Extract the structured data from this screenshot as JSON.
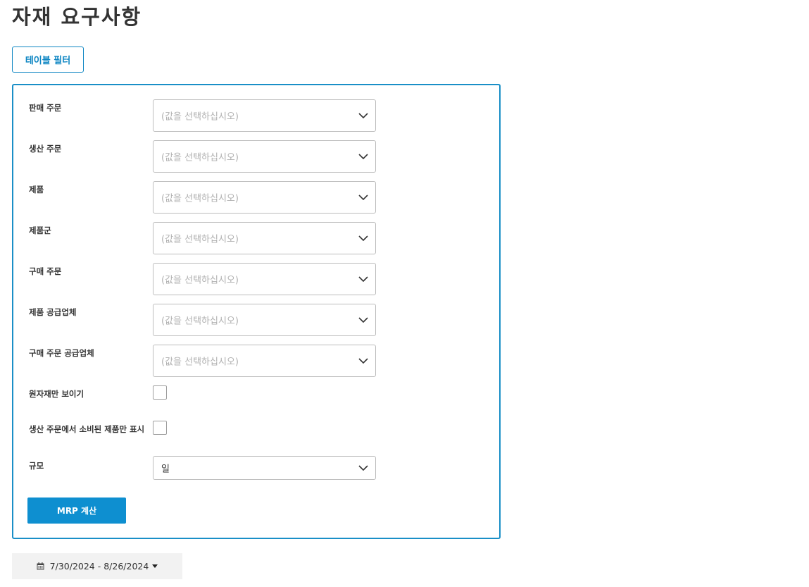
{
  "page": {
    "title": "자재 요구사항"
  },
  "toolbar": {
    "filter_toggle_label": "테이블 필터"
  },
  "filters": {
    "fields": [
      {
        "label": "판매 주문",
        "placeholder": "(값을 선택하십시오)"
      },
      {
        "label": "생산 주문",
        "placeholder": "(값을 선택하십시오)"
      },
      {
        "label": "제품",
        "placeholder": "(값을 선택하십시오)"
      },
      {
        "label": "제품군",
        "placeholder": "(값을 선택하십시오)"
      },
      {
        "label": "구매 주문",
        "placeholder": "(값을 선택하십시오)"
      },
      {
        "label": "제품 공급업체",
        "placeholder": "(값을 선택하십시오)"
      },
      {
        "label": "구매 주문 공급업체",
        "placeholder": "(값을 선택하십시오)"
      }
    ],
    "checkboxes": [
      {
        "label": "원자재만 보이기",
        "checked": false
      },
      {
        "label": "생산 주문에서 소비된 제품만 표시",
        "checked": false
      }
    ],
    "scale": {
      "label": "규모",
      "value": "일"
    },
    "submit_label": "MRP 계산"
  },
  "date_range": {
    "label": "7/30/2024 - 8/26/2024",
    "icon": "calendar-icon"
  },
  "colors": {
    "accent": "#0e8fd0",
    "panel_border": "#1a8fc7",
    "placeholder": "#b0b0b0"
  }
}
